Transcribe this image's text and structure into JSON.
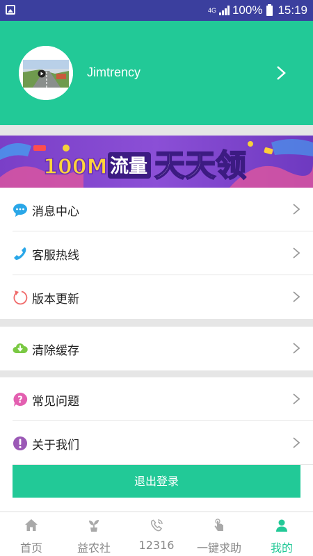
{
  "status_bar": {
    "network": "4G",
    "battery": "100%",
    "time": "15:19"
  },
  "profile": {
    "username": "Jimtrency"
  },
  "banner": {
    "text_left": "100M",
    "text_mid": "流量",
    "text_right": "天天领"
  },
  "menu": {
    "message_center": "消息中心",
    "service_hotline": "客服热线",
    "version_update": "版本更新",
    "clear_cache": "清除缓存",
    "faq": "常见问题",
    "about_us": "关于我们"
  },
  "logout_label": "退出登录",
  "bottom_nav": {
    "home": "首页",
    "yinongshe": "益农社",
    "hotline": "12316",
    "help": "一键求助",
    "mine": "我的"
  },
  "colors": {
    "accent": "#22c997",
    "status_bar": "#3b3f9e"
  }
}
